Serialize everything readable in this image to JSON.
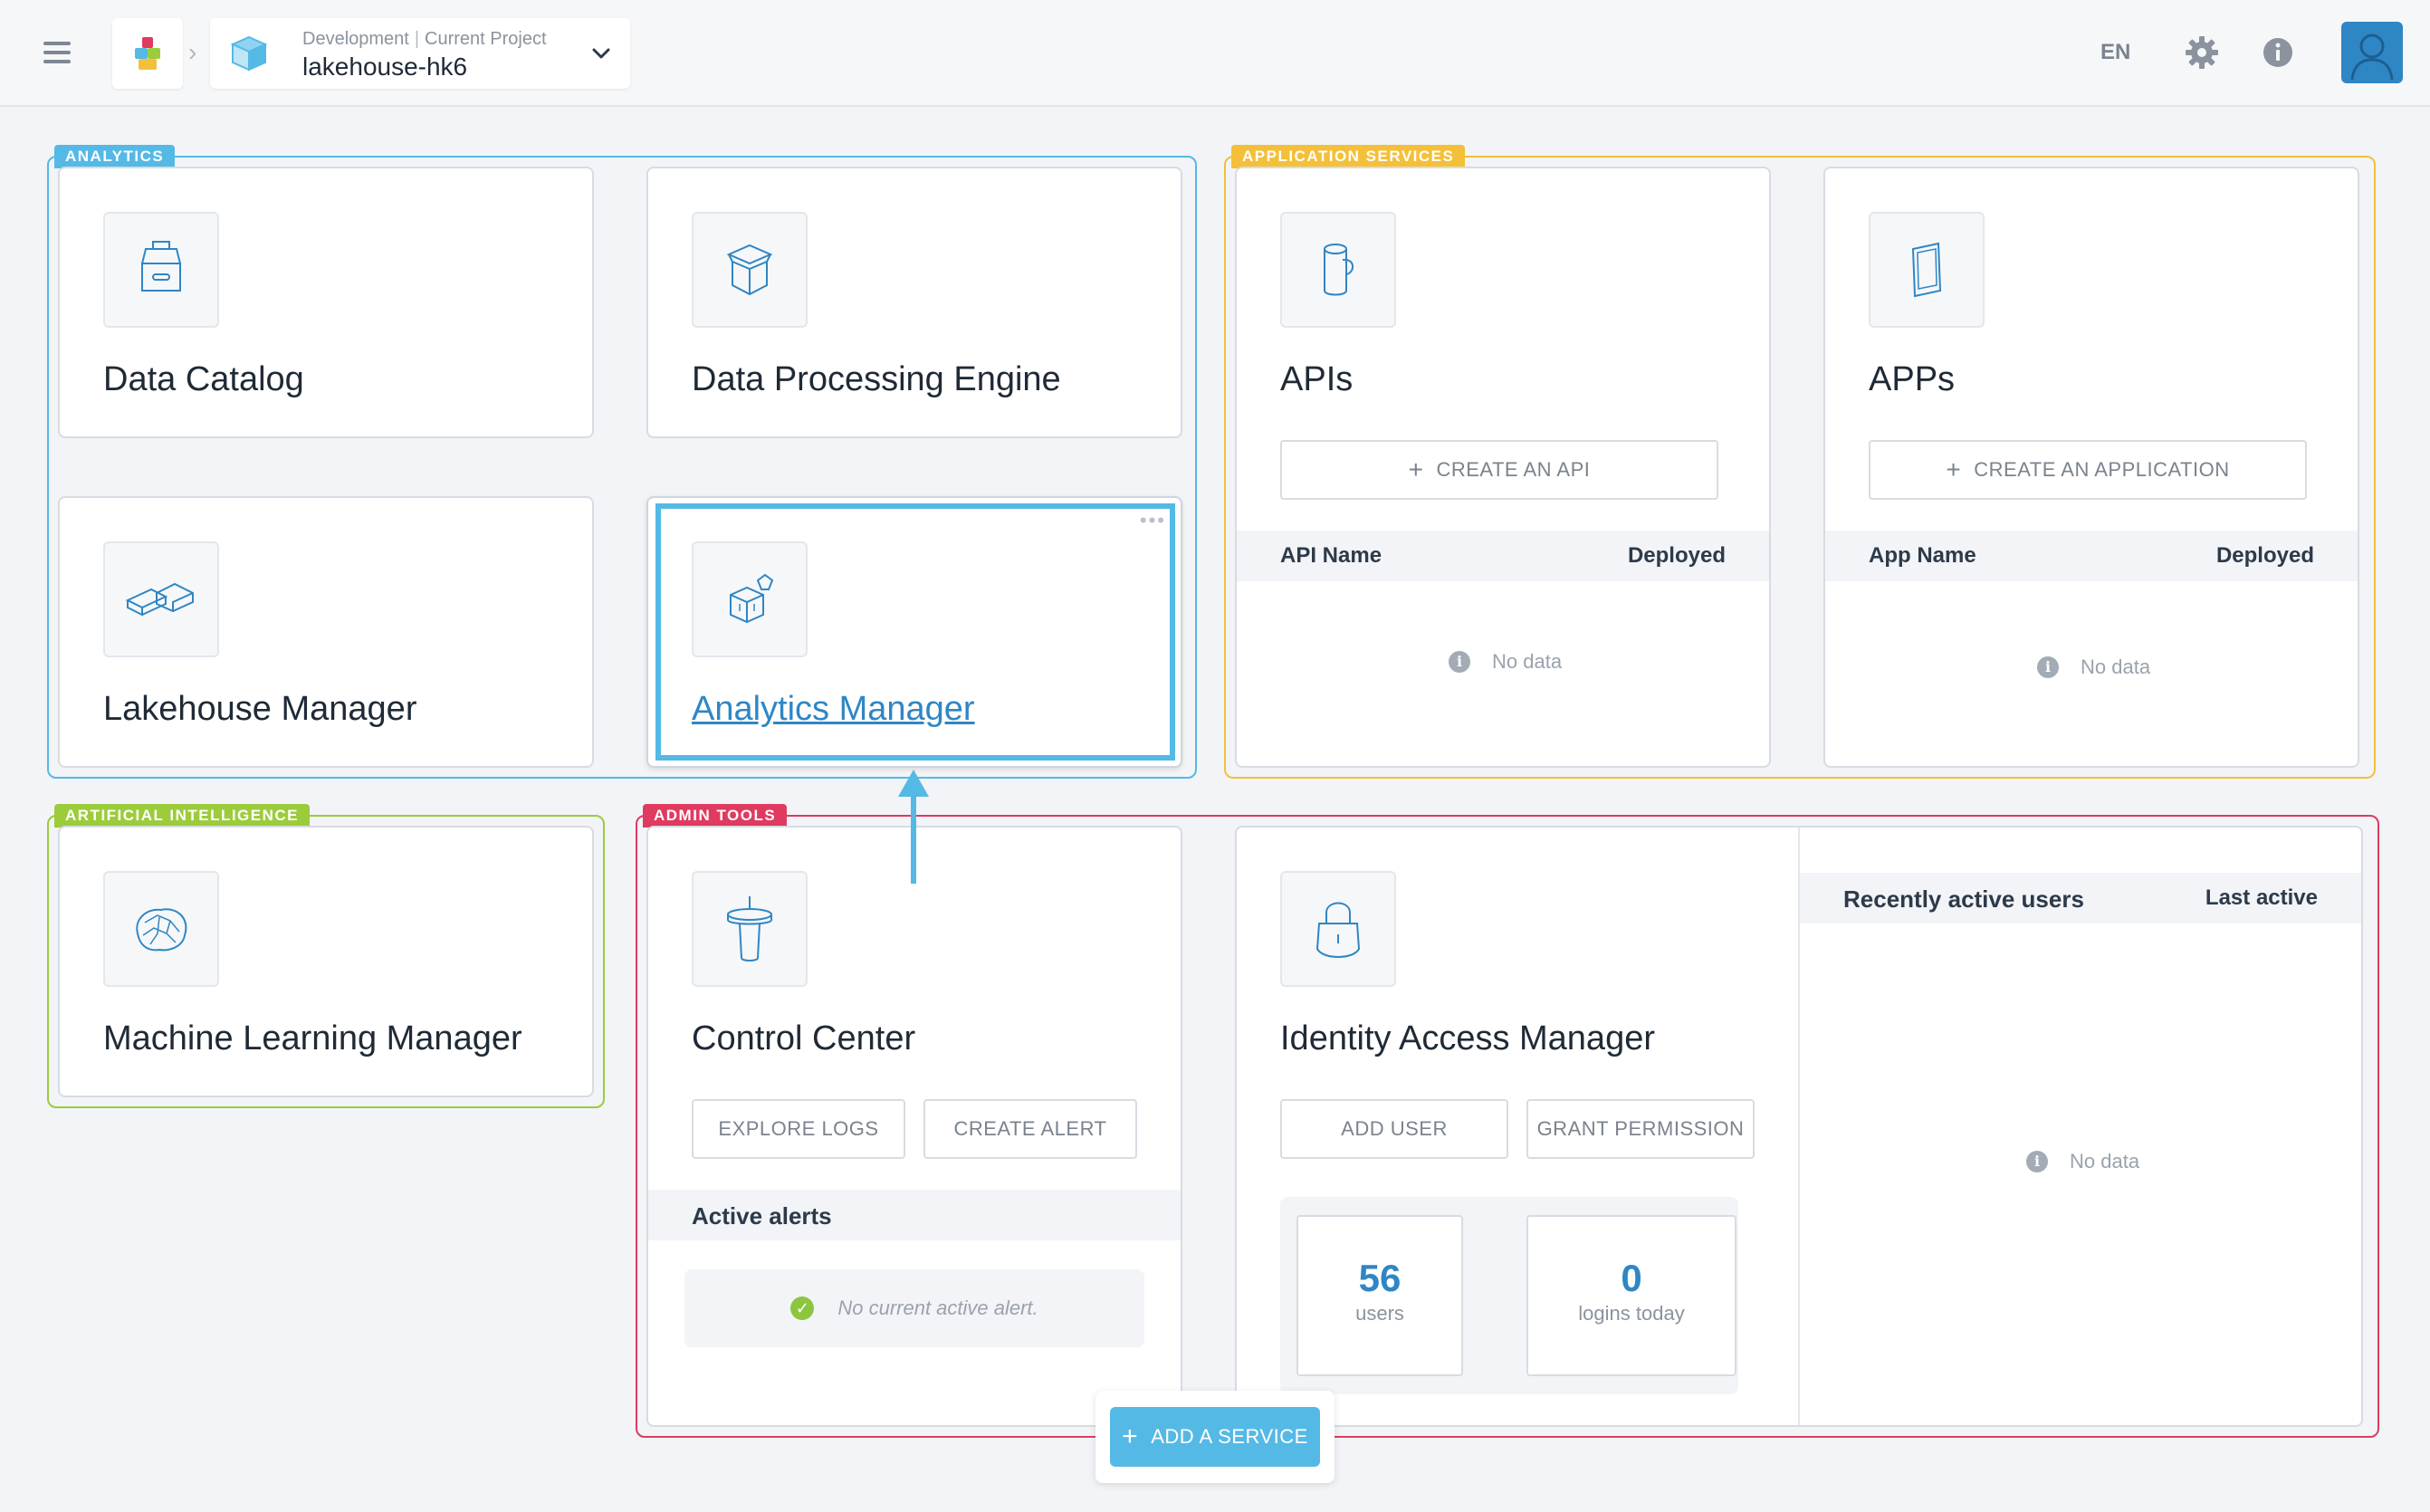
{
  "header": {
    "env": "Development",
    "env_sub": "Current Project",
    "project": "lakehouse-hk6",
    "lang": "EN"
  },
  "sections": {
    "analytics": "ANALYTICS",
    "app_services": "APPLICATION SERVICES",
    "ai": "ARTIFICIAL INTELLIGENCE",
    "admin": "ADMIN TOOLS"
  },
  "cards": {
    "data_catalog": "Data Catalog",
    "dpe": "Data Processing Engine",
    "lakehouse": "Lakehouse Manager",
    "analytics": "Analytics Manager",
    "apis": "APIs",
    "apps": "APPs",
    "ml": "Machine Learning Manager",
    "control_center": "Control Center",
    "iam": "Identity Access Manager"
  },
  "apis": {
    "create": "CREATE AN API",
    "col_name": "API Name",
    "col_deployed": "Deployed",
    "empty": "No data"
  },
  "apps": {
    "create": "CREATE AN APPLICATION",
    "col_name": "App Name",
    "col_deployed": "Deployed",
    "empty": "No data"
  },
  "control_center": {
    "explore_logs": "EXPLORE LOGS",
    "create_alert": "CREATE ALERT",
    "alerts_title": "Active alerts",
    "no_alert": "No current active alert."
  },
  "iam": {
    "add_user": "ADD USER",
    "grant_permission": "GRANT PERMISSION",
    "users_count": "56",
    "users_label": "users",
    "logins_count": "0",
    "logins_label": "logins today",
    "recent_title": "Recently active users",
    "last_active": "Last active",
    "empty": "No data"
  },
  "add_service": "ADD A SERVICE",
  "colors": {
    "analytics": "#55b9e6",
    "app_services": "#f4c03a",
    "ai": "#9ccc3c",
    "admin": "#e03a60",
    "accent": "#2f86c4"
  }
}
